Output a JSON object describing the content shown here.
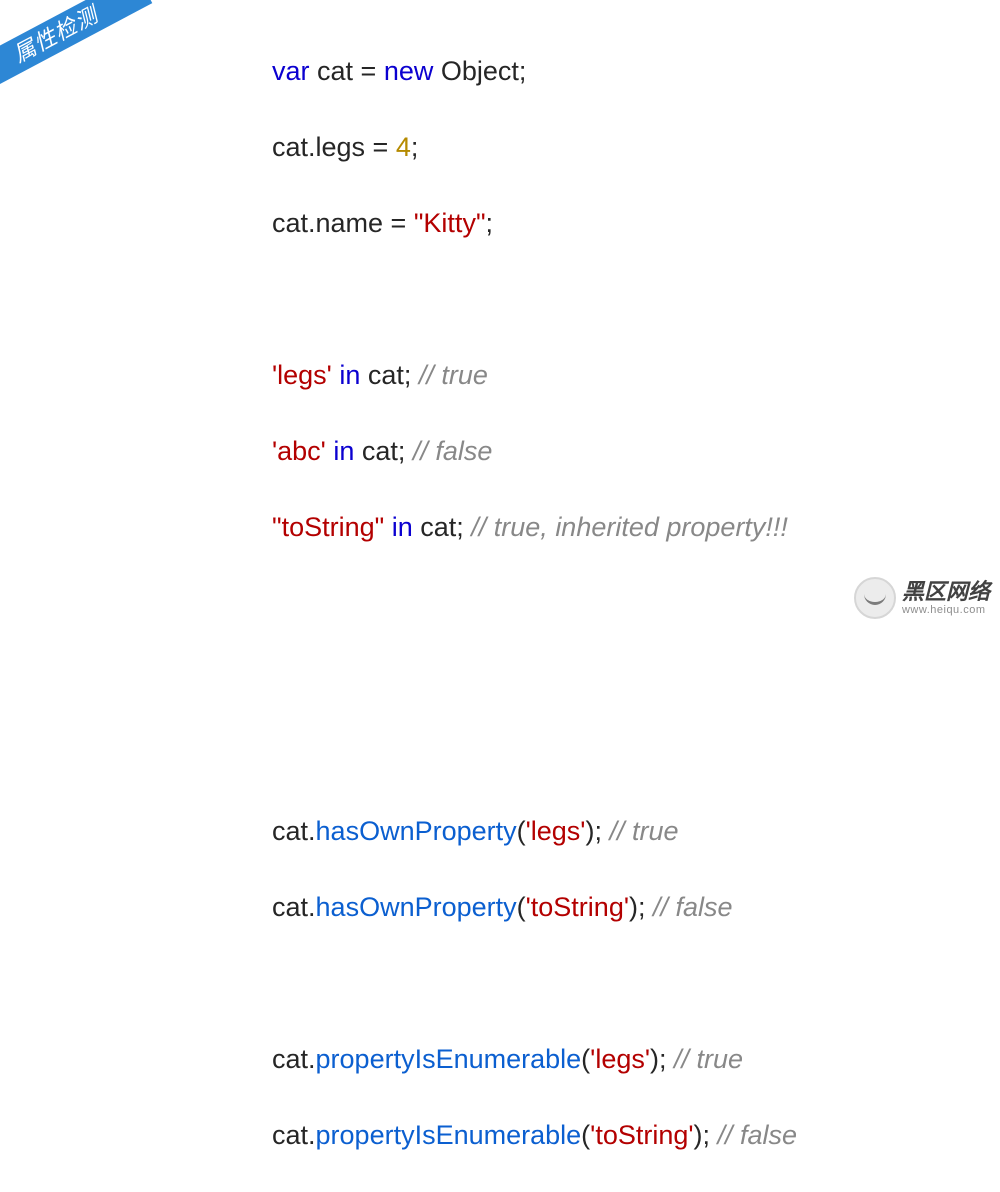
{
  "ribbon": {
    "label": "属性检测"
  },
  "code": {
    "l1": {
      "kw": "var",
      "a": " cat = ",
      "new": "new",
      "b": " Object;"
    },
    "l2": {
      "a": "cat.legs = ",
      "num": "4",
      "b": ";"
    },
    "l3": {
      "a": "cat.name = ",
      "str": "\"Kitty\"",
      "b": ";"
    },
    "l4": {
      "str": "'legs'",
      "a": " ",
      "kw": "in",
      "b": " cat; ",
      "cmt": "// true"
    },
    "l5": {
      "str": "'abc'",
      "a": " ",
      "kw": "in",
      "b": " cat; ",
      "cmt": "// false"
    },
    "l6": {
      "str": "\"toString\"",
      "a": " ",
      "kw": "in",
      "b": " cat; ",
      "cmt": "// true, inherited property!!!"
    },
    "l7": {
      "a": "cat.",
      "fn": "hasOwnProperty",
      "b": "(",
      "str": "'legs'",
      "c": "); ",
      "cmt": "// true"
    },
    "l8": {
      "a": "cat.",
      "fn": "hasOwnProperty",
      "b": "(",
      "str": "'toString'",
      "c": "); ",
      "cmt": "// false"
    },
    "l9": {
      "a": "cat.",
      "fn": "propertyIsEnumerable",
      "b": "(",
      "str": "'legs'",
      "c": "); ",
      "cmt": "// true"
    },
    "l10": {
      "a": "cat.",
      "fn": "propertyIsEnumerable",
      "b": "(",
      "str": "'toString'",
      "c": "); ",
      "cmt": "// false"
    }
  },
  "watermark": {
    "big": "黑区网络",
    "small": "www.heiqu.com"
  }
}
